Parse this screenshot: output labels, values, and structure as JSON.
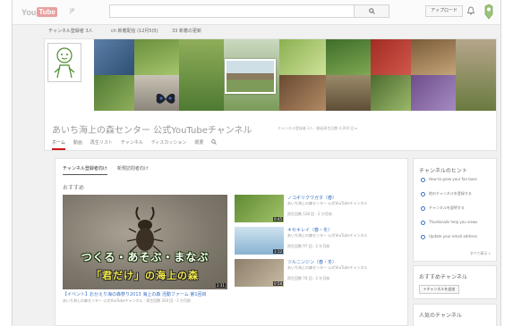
{
  "header": {
    "logo_you": "You",
    "logo_tube": "Tube",
    "locale": "JP",
    "search_placeholder": "",
    "upload_label": "アップロード"
  },
  "guide": {
    "items": [
      "チャンネル登録者 3人",
      "ch 新着配信 (12月5日)",
      "33 新着の更新"
    ]
  },
  "channel": {
    "title": "あいち海上の森センター 公式YouTubeチャンネル",
    "subtitle": "チャンネル登録者 3人 · 動画再生回数 4,000 回 ▾",
    "tabs": [
      "ホーム",
      "動画",
      "再生リスト",
      "チャンネル",
      "ディスカッション",
      "概要"
    ]
  },
  "content": {
    "subtabs": [
      "チャンネル登録者向け",
      "新規訪問者向け"
    ],
    "section_title": "おすすめ",
    "featured": {
      "overlay_line1": "つくる・あそぶ・まなぶ",
      "overlay_line2": "「君だけ」の海上の森",
      "duration": "2:31",
      "title": "【イベント】おかえり海の森祭り2013 海上の森 活動ファーム 第1回目",
      "meta": "あいち海上の森センター 公式YouTubeチャンネル · 再生回数 320 回 · 1 か月前"
    },
    "videos": [
      {
        "title": "ノコギリクワガタ（春）",
        "desc": "あいち海上の森センター 公式YouTubeチャンネル",
        "meta": "再生回数 128 回 · 2 か月前",
        "duration": "0:45"
      },
      {
        "title": "キセキレイ（春・冬）",
        "desc": "あいち海上の森センター 公式YouTubeチャンネル",
        "meta": "再生回数 97 回 · 2 か月前",
        "duration": "1:12"
      },
      {
        "title": "ツルニンジン（春・冬）",
        "desc": "あいち海上の森センター 公式YouTubeチャンネル",
        "meta": "再生回数 76 回 · 2 か月前",
        "duration": "0:58"
      }
    ]
  },
  "sidebar": {
    "tips_title": "チャンネルのヒント",
    "tips": [
      "How to grow your fan base",
      "他のチャンネルを登録する",
      "チャンネルを説明する",
      "Thumbnails help you views",
      "Update your email address"
    ],
    "tips_more": "すべて表示 »",
    "featured_title": "おすすめチャンネル",
    "featured_button": "+チャンネルを追加",
    "popular_title": "人気のチャンネル"
  },
  "colors": {
    "accent": "#cc181e",
    "link": "#3a73c4"
  }
}
